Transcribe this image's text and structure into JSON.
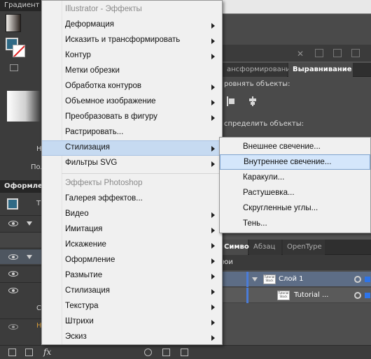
{
  "left_panel": {
    "title": "Градиент",
    "letter_h": "Н",
    "label_pol": "Пол",
    "appearance_title": "Оформле",
    "letter_t": "Т",
    "letter_c": "С",
    "letter_h2": "Н"
  },
  "align_panel": {
    "tab_transform": "ансформирование",
    "tab_align": "Выравнивание",
    "align_objects": "ровнять объекты:",
    "distribute_objects": "спределить объекты:"
  },
  "layers_panel": {
    "tabs": [
      "Символ",
      "Абзац",
      "OpenType"
    ],
    "header": "юи",
    "rows": [
      {
        "name": "Слой 1",
        "thumb": "Tutorial Stock"
      },
      {
        "name": "Tutorial ...",
        "thumb": "Tutorial Stock"
      }
    ]
  },
  "menu": {
    "items": [
      {
        "label": "Illustrator - Эффекты",
        "type": "header"
      },
      {
        "label": "Деформация",
        "submenu": true
      },
      {
        "label": "Исказить и трансформировать",
        "submenu": true
      },
      {
        "label": "Контур",
        "submenu": true
      },
      {
        "label": "Метки обрезки",
        "submenu": false
      },
      {
        "label": "Обработка контуров",
        "submenu": true
      },
      {
        "label": "Объемное изображение",
        "submenu": true
      },
      {
        "label": "Преобразовать в фигуру",
        "submenu": true
      },
      {
        "label": "Растрировать...",
        "submenu": false
      },
      {
        "label": "Стилизация",
        "submenu": true,
        "highlighted": true
      },
      {
        "label": "Фильтры SVG",
        "submenu": true
      },
      {
        "label": "Эффекты Photoshop",
        "type": "header"
      },
      {
        "label": "Галерея эффектов...",
        "submenu": false
      },
      {
        "label": "Видео",
        "submenu": true
      },
      {
        "label": "Имитация",
        "submenu": true
      },
      {
        "label": "Искажение",
        "submenu": true
      },
      {
        "label": "Оформление",
        "submenu": true
      },
      {
        "label": "Размытие",
        "submenu": true
      },
      {
        "label": "Стилизация",
        "submenu": true
      },
      {
        "label": "Текстура",
        "submenu": true
      },
      {
        "label": "Штрихи",
        "submenu": true
      },
      {
        "label": "Эскиз",
        "submenu": true
      }
    ]
  },
  "submenu": {
    "items": [
      {
        "label": "Внешнее свечение..."
      },
      {
        "label": "Внутреннее свечение...",
        "highlighted": true
      },
      {
        "label": "Каракули..."
      },
      {
        "label": "Растушевка..."
      },
      {
        "label": "Скругленные углы..."
      },
      {
        "label": "Тень..."
      }
    ]
  },
  "bottom_bar": {
    "fx_label": "fx"
  },
  "colors": {
    "menu_bg": "#f0f0f0",
    "highlight": "#c6daf1",
    "panel_dark": "#3c3c3c",
    "accent_blue": "#2e74e8"
  }
}
